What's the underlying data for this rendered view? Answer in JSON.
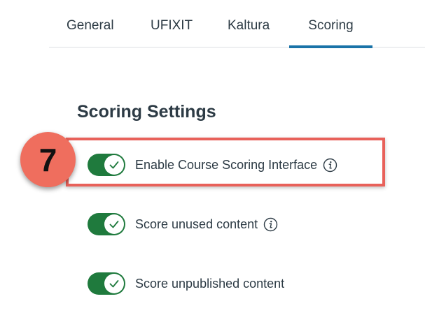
{
  "tabs": [
    {
      "label": "General",
      "active": false
    },
    {
      "label": "UFIXIT",
      "active": false
    },
    {
      "label": "Kaltura",
      "active": false
    },
    {
      "label": "Scoring",
      "active": true
    }
  ],
  "section": {
    "title": "Scoring Settings"
  },
  "annotation": {
    "step_number": "7"
  },
  "settings": [
    {
      "label": "Enable Course Scoring Interface",
      "enabled": true,
      "has_info": true
    },
    {
      "label": "Score unused content",
      "enabled": true,
      "has_info": true
    },
    {
      "label": "Score unpublished content",
      "enabled": true,
      "has_info": false
    }
  ],
  "colors": {
    "toggle_on": "#1f7a3d",
    "tab_active_underline": "#1a73a8",
    "highlight": "#e8615a",
    "badge": "#ef6e5e",
    "text": "#2d3b45"
  },
  "icons": {
    "toggle_knob": "check-icon",
    "info": "info-icon"
  }
}
